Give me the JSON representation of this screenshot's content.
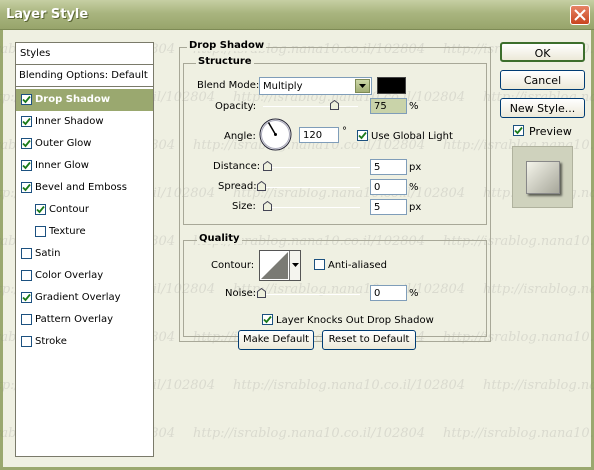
{
  "window": {
    "title": "Layer Style"
  },
  "watermark_text": "http://israblog.nana10.co.il/102804",
  "sidebar": {
    "header": "Styles",
    "blending_options": "Blending Options: Default",
    "items": [
      {
        "label": "Drop Shadow",
        "checked": true,
        "selected": true,
        "indent": false
      },
      {
        "label": "Inner Shadow",
        "checked": true,
        "selected": false,
        "indent": false
      },
      {
        "label": "Outer Glow",
        "checked": true,
        "selected": false,
        "indent": false
      },
      {
        "label": "Inner Glow",
        "checked": true,
        "selected": false,
        "indent": false
      },
      {
        "label": "Bevel and Emboss",
        "checked": true,
        "selected": false,
        "indent": false
      },
      {
        "label": "Contour",
        "checked": true,
        "selected": false,
        "indent": true
      },
      {
        "label": "Texture",
        "checked": false,
        "selected": false,
        "indent": true
      },
      {
        "label": "Satin",
        "checked": false,
        "selected": false,
        "indent": false
      },
      {
        "label": "Color Overlay",
        "checked": false,
        "selected": false,
        "indent": false
      },
      {
        "label": "Gradient Overlay",
        "checked": true,
        "selected": false,
        "indent": false
      },
      {
        "label": "Pattern Overlay",
        "checked": false,
        "selected": false,
        "indent": false
      },
      {
        "label": "Stroke",
        "checked": false,
        "selected": false,
        "indent": false
      }
    ]
  },
  "drop_shadow": {
    "title": "Drop Shadow",
    "structure": {
      "title": "Structure",
      "blend_mode_label": "Blend Mode:",
      "blend_mode_value": "Multiply",
      "shadow_color": "#000000",
      "opacity_label": "Opacity:",
      "opacity_value": "75",
      "opacity_unit": "%",
      "opacity_level": 0.75,
      "angle_label": "Angle:",
      "angle_value": "120",
      "angle_unit": "°",
      "use_global_light_label": "Use Global Light",
      "use_global_light": true,
      "distance_label": "Distance:",
      "distance_value": "5",
      "distance_unit": "px",
      "distance_level": 0.02,
      "spread_label": "Spread:",
      "spread_value": "0",
      "spread_unit": "%",
      "spread_level": 0,
      "size_label": "Size:",
      "size_value": "5",
      "size_unit": "px",
      "size_level": 0.02
    },
    "quality": {
      "title": "Quality",
      "contour_label": "Contour:",
      "anti_aliased_label": "Anti-aliased",
      "anti_aliased": false,
      "noise_label": "Noise:",
      "noise_value": "0",
      "noise_unit": "%",
      "noise_level": 0
    },
    "knockout_label": "Layer Knocks Out Drop Shadow",
    "knockout": true,
    "make_default_label": "Make Default",
    "reset_default_label": "Reset to Default"
  },
  "buttons": {
    "ok": "OK",
    "cancel": "Cancel",
    "new_style": "New Style...",
    "preview_label": "Preview",
    "preview": true
  },
  "colors": {
    "accent": "#9aa86f",
    "titlebar": "#a9b57f",
    "background": "#eff0e2"
  }
}
